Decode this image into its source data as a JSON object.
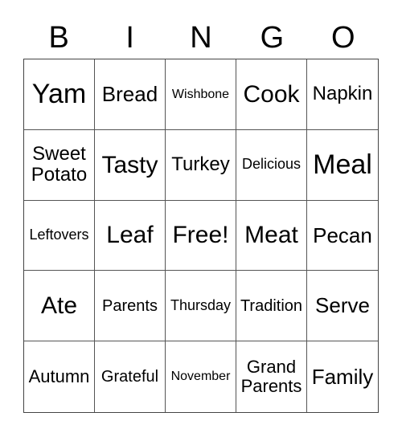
{
  "header": [
    "B",
    "I",
    "N",
    "G",
    "O"
  ],
  "cells": [
    "Yam",
    "Bread",
    "Wishbone",
    "Cook",
    "Napkin",
    "Sweet\nPotato",
    "Tasty",
    "Turkey",
    "Delicious",
    "Meal",
    "Leftovers",
    "Leaf",
    "Free!",
    "Meat",
    "Pecan",
    "Ate",
    "Parents",
    "Thursday",
    "Tradition",
    "Serve",
    "Autumn",
    "Grateful",
    "November",
    "Grand\nParents",
    "Family"
  ]
}
